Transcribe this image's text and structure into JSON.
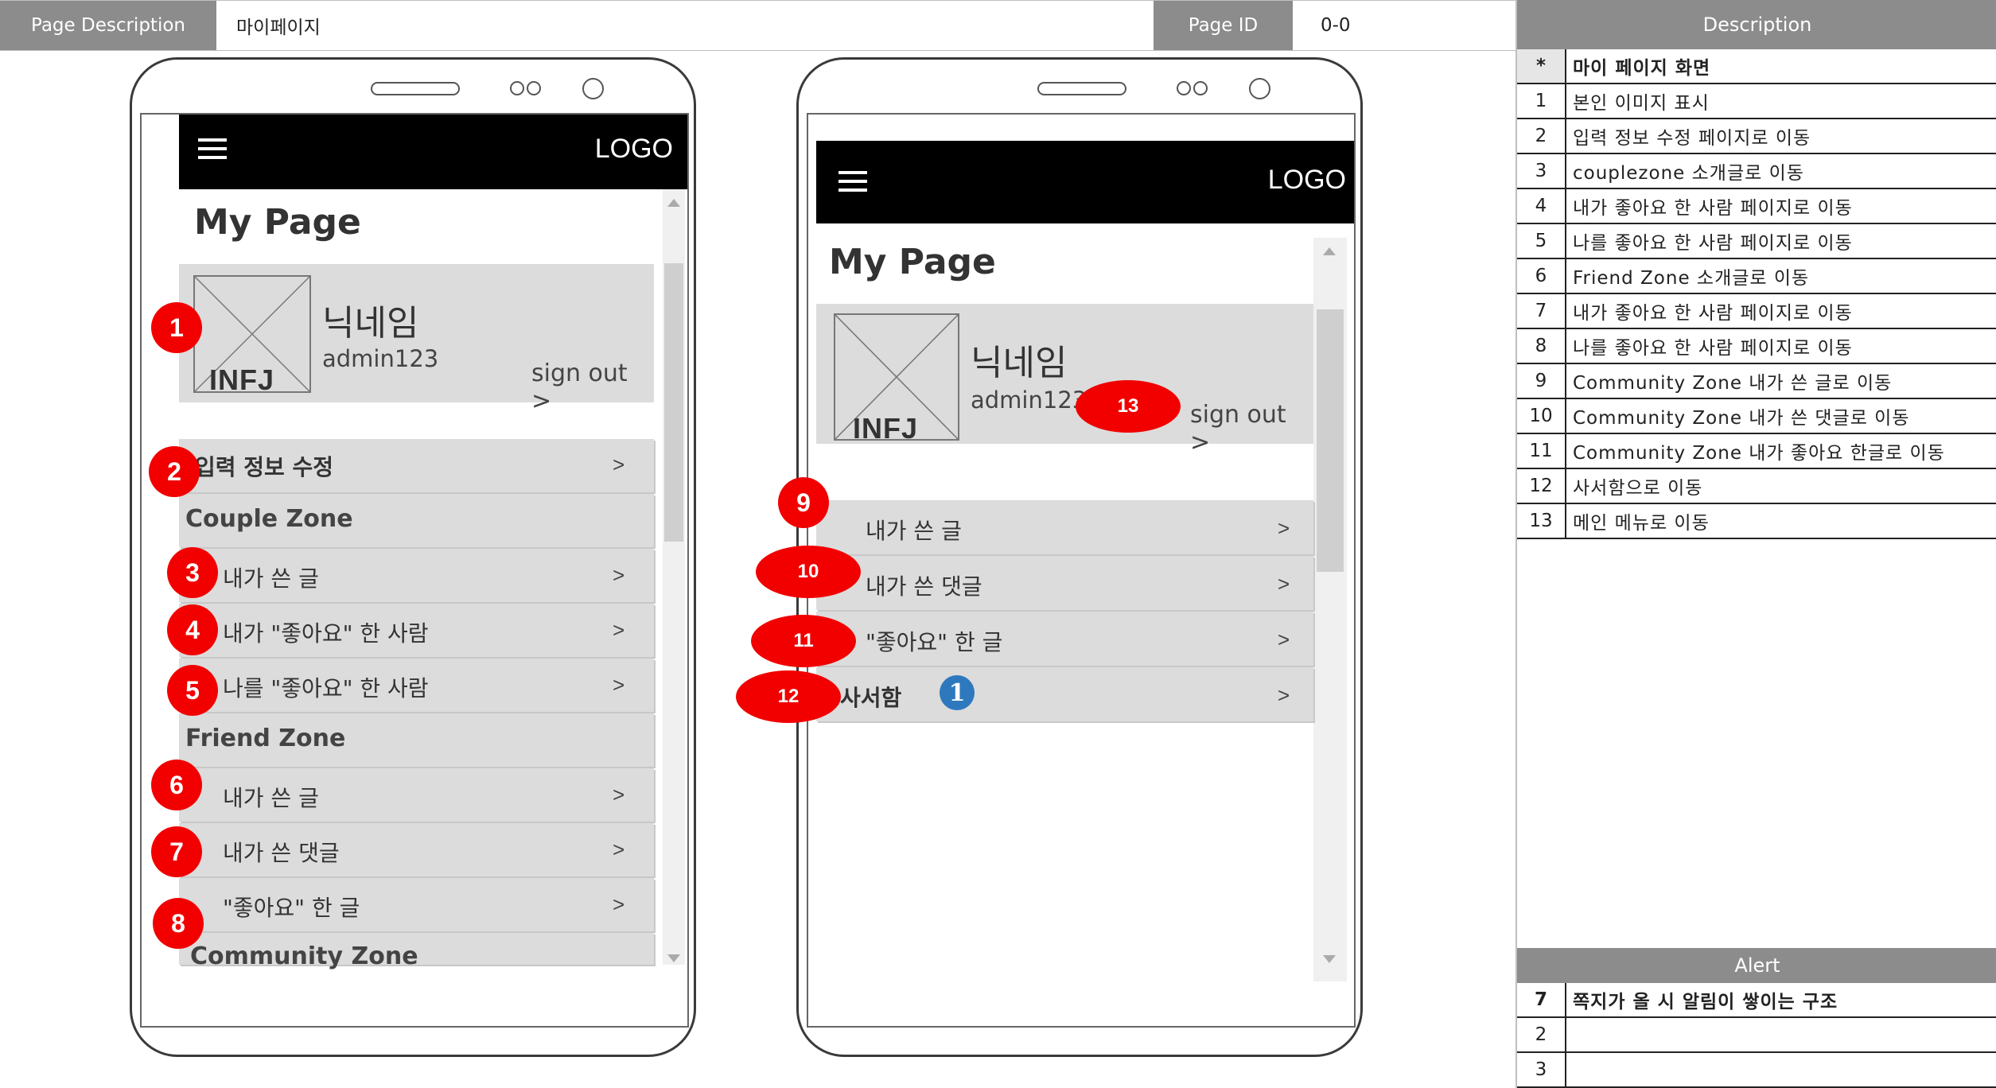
{
  "header": {
    "page_description_label": "Page Description",
    "page_description_value": "마이페이지",
    "page_id_label": "Page ID",
    "page_id_value": "0-0"
  },
  "description": {
    "title": "Description",
    "rows": [
      {
        "num": "*",
        "text": "마이 페이지 화면"
      },
      {
        "num": "1",
        "text": "본인 이미지 표시"
      },
      {
        "num": "2",
        "text": "입력 정보 수정 페이지로 이동"
      },
      {
        "num": "3",
        "text": "couplezone 소개글로 이동"
      },
      {
        "num": "4",
        "text": "내가 좋아요 한 사람 페이지로 이동"
      },
      {
        "num": "5",
        "text": "나를 좋아요 한 사람 페이지로 이동"
      },
      {
        "num": "6",
        "text": "Friend Zone 소개글로 이동"
      },
      {
        "num": "7",
        "text": "내가 좋아요 한 사람 페이지로 이동"
      },
      {
        "num": "8",
        "text": "나를 좋아요 한 사람 페이지로 이동"
      },
      {
        "num": "9",
        "text": "Community Zone 내가 쓴 글로 이동"
      },
      {
        "num": "10",
        "text": "Community Zone 내가 쓴 댓글로 이동"
      },
      {
        "num": "11",
        "text": "Community Zone 내가 좋아요 한글로 이동"
      },
      {
        "num": "12",
        "text": "사서함으로 이동"
      },
      {
        "num": "13",
        "text": "메인 메뉴로 이동"
      }
    ]
  },
  "alert": {
    "title": "Alert",
    "rows": [
      {
        "num": "7",
        "text": "쪽지가 올 시 알림이 쌓이는 구조"
      },
      {
        "num": "2",
        "text": ""
      },
      {
        "num": "3",
        "text": ""
      }
    ]
  },
  "phone1": {
    "logo": "LOGO",
    "title": "My Page",
    "nickname": "닉네임",
    "user_id": "admin123",
    "mbti": "INFJ",
    "sign_out": "sign out >",
    "edit_info": "입력 정보 수정",
    "couple_zone": "Couple Zone",
    "friend_zone": "Friend Zone",
    "community_zone": "Community Zone",
    "couple_items": [
      "내가 쓴 글",
      "내가 \"좋아요\" 한 사람",
      "나를 \"좋아요\" 한 사람"
    ],
    "friend_items": [
      "내가 쓴 글",
      "내가 쓴 댓글",
      "\"좋아요\" 한 글"
    ],
    "arrow": ">"
  },
  "phone2": {
    "logo": "LOGO",
    "title": "My Page",
    "nickname": "닉네임",
    "user_id": "admin123",
    "mbti": "INFJ",
    "sign_out": "sign out >",
    "community_items": [
      "내가 쓴 글",
      "내가 쓴 댓글",
      "\"좋아요\" 한 글"
    ],
    "mailbox": "사서함",
    "mailbox_badge": "1",
    "arrow": ">"
  },
  "markers": [
    "1",
    "2",
    "3",
    "4",
    "5",
    "6",
    "7",
    "8",
    "9",
    "10",
    "11",
    "12",
    "13"
  ],
  "colors": {
    "marker": "#f20000",
    "badge": "#2e79bd",
    "header_gray": "#8c8c8c",
    "menu_gray": "#dcdcdc",
    "appbar": "#000000"
  },
  "icons": [
    "hamburger-icon",
    "placeholder-image-icon",
    "scroll-up-icon",
    "scroll-down-icon"
  ]
}
